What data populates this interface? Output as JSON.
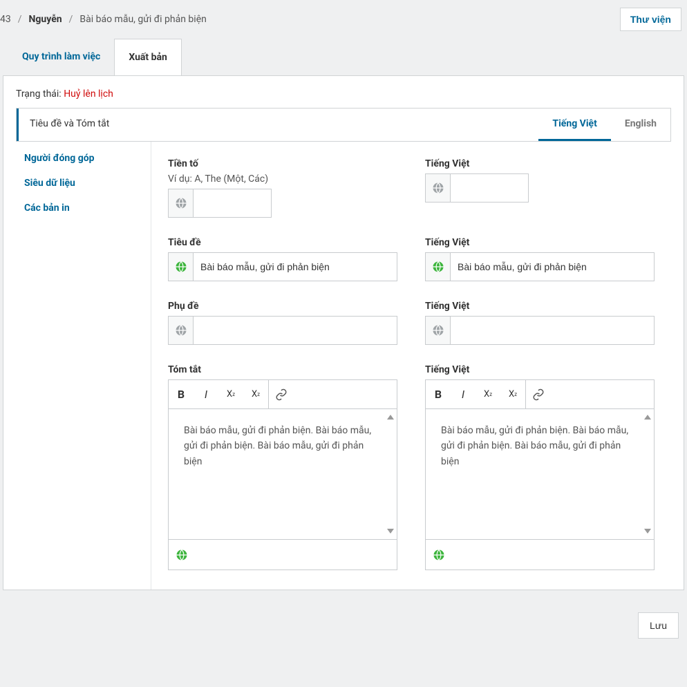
{
  "breadcrumb": {
    "id": "43",
    "author": "Nguyễn",
    "title": "Bài báo mẫu, gửi đi phản biện"
  },
  "header": {
    "library_button": "Thư viện"
  },
  "tabs": {
    "workflow": "Quy trình làm việc",
    "publication": "Xuất bản"
  },
  "status": {
    "label": "Trạng thái:",
    "value": "Huỷ lên lịch"
  },
  "section_tabs": {
    "title_abstract": "Tiêu đề và Tóm tắt",
    "lang_vi": "Tiếng Việt",
    "lang_en": "English"
  },
  "sidebar": {
    "contributors": "Người đóng góp",
    "metadata": "Siêu dữ liệu",
    "galleys": "Các bản in"
  },
  "form": {
    "prefix": {
      "label": "Tiền tố",
      "help": "Ví dụ: A, The (Một, Các)",
      "value_left": "",
      "label_right": "Tiếng Việt",
      "value_right": ""
    },
    "title": {
      "label": "Tiêu đề",
      "value_left": "Bài báo mẫu, gửi đi phản biện",
      "label_right": "Tiếng Việt",
      "value_right": "Bài báo mẫu, gửi đi phản biện"
    },
    "subtitle": {
      "label": "Phụ đề",
      "value_left": "",
      "label_right": "Tiếng Việt",
      "value_right": ""
    },
    "abstract": {
      "label": "Tóm tắt",
      "label_right": "Tiếng Việt",
      "value_left": "Bài báo mẫu, gửi đi phản biện. Bài báo mẫu, gửi đi phản biện. Bài báo mẫu, gửi đi phản biện",
      "value_right": "Bài báo mẫu, gửi đi phản biện. Bài báo mẫu, gửi đi phản biện. Bài báo mẫu, gửi đi phản biện"
    }
  },
  "save_button": "Lưu",
  "icons": {
    "globe_gray": "#9fa4a7",
    "globe_green": "#3db53d"
  }
}
